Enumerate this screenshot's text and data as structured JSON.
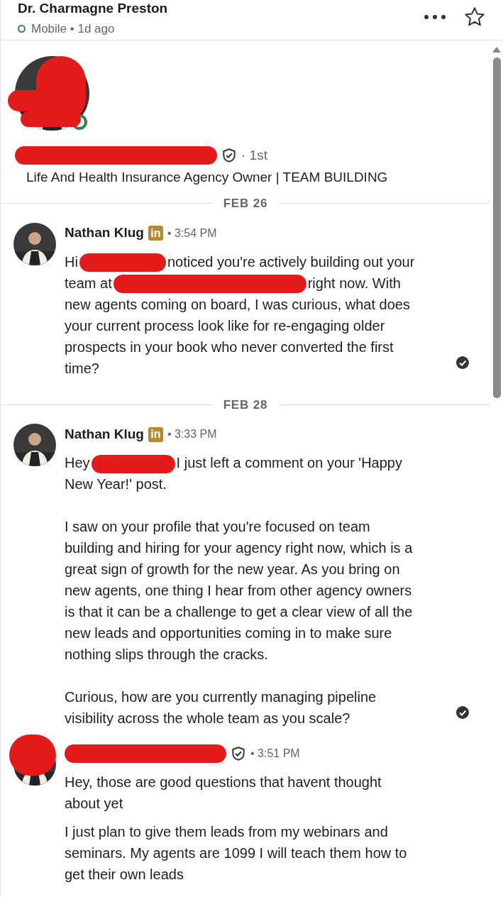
{
  "header": {
    "title": "Dr. Charmagne Preston",
    "online": true,
    "status": "Mobile • 1d ago"
  },
  "profile": {
    "online": true,
    "verified": true,
    "degree": "· 1st",
    "headline": "Life And Health Insurance Agency Owner | TEAM BUILDING"
  },
  "days": [
    {
      "date": "FEB 26",
      "messages": [
        {
          "sender": "Nathan Klug",
          "sender_redacted": false,
          "badge": "in",
          "verified": false,
          "time": "• 3:54 PM",
          "seen": true,
          "bubbles": [
            [
              [
                {
                  "kind": "text",
                  "text": "Hi"
                },
                {
                  "kind": "redaction"
                },
                {
                  "kind": "text",
                  "text": "noticed you're actively building out your team at"
                },
                {
                  "kind": "redaction"
                },
                {
                  "kind": "text",
                  "text": "right now. With new agents coming on board, I was curious, what does your current process look like for re-engaging older prospects in your book who never converted the first time?"
                }
              ]
            ]
          ]
        }
      ]
    },
    {
      "date": "FEB 28",
      "messages": [
        {
          "sender": "Nathan Klug",
          "sender_redacted": false,
          "badge": "in",
          "verified": false,
          "time": "• 3:33 PM",
          "seen": true,
          "bubbles": [
            [
              [
                {
                  "kind": "text",
                  "text": "Hey"
                },
                {
                  "kind": "redaction"
                },
                {
                  "kind": "text",
                  "text": "I just left a comment on your 'Happy New Year!' post."
                }
              ],
              [
                {
                  "kind": "text",
                  "text": "I saw on your profile that you're focused on team building and hiring for your agency right now, which is a great sign of growth for the new year. As you bring on new agents, one thing I hear from other agency owners is that it can be a challenge to get a clear view of all the new leads and opportunities coming in to make sure nothing slips through the cracks."
                }
              ],
              [
                {
                  "kind": "text",
                  "text": "Curious, how are you currently managing pipeline visibility across the whole team as you scale?"
                }
              ]
            ]
          ]
        },
        {
          "sender_redacted": true,
          "verified": true,
          "time": "• 3:51 PM",
          "seen": false,
          "bubbles": [
            [
              [
                {
                  "kind": "text",
                  "text": "Hey, those are good questions that havent thought about yet"
                }
              ]
            ],
            [
              [
                {
                  "kind": "text",
                  "text": "I just plan to give them leads from my webinars and seminars. My agents are 1099 I will teach them how to get their own leads"
                }
              ]
            ]
          ]
        }
      ]
    }
  ]
}
